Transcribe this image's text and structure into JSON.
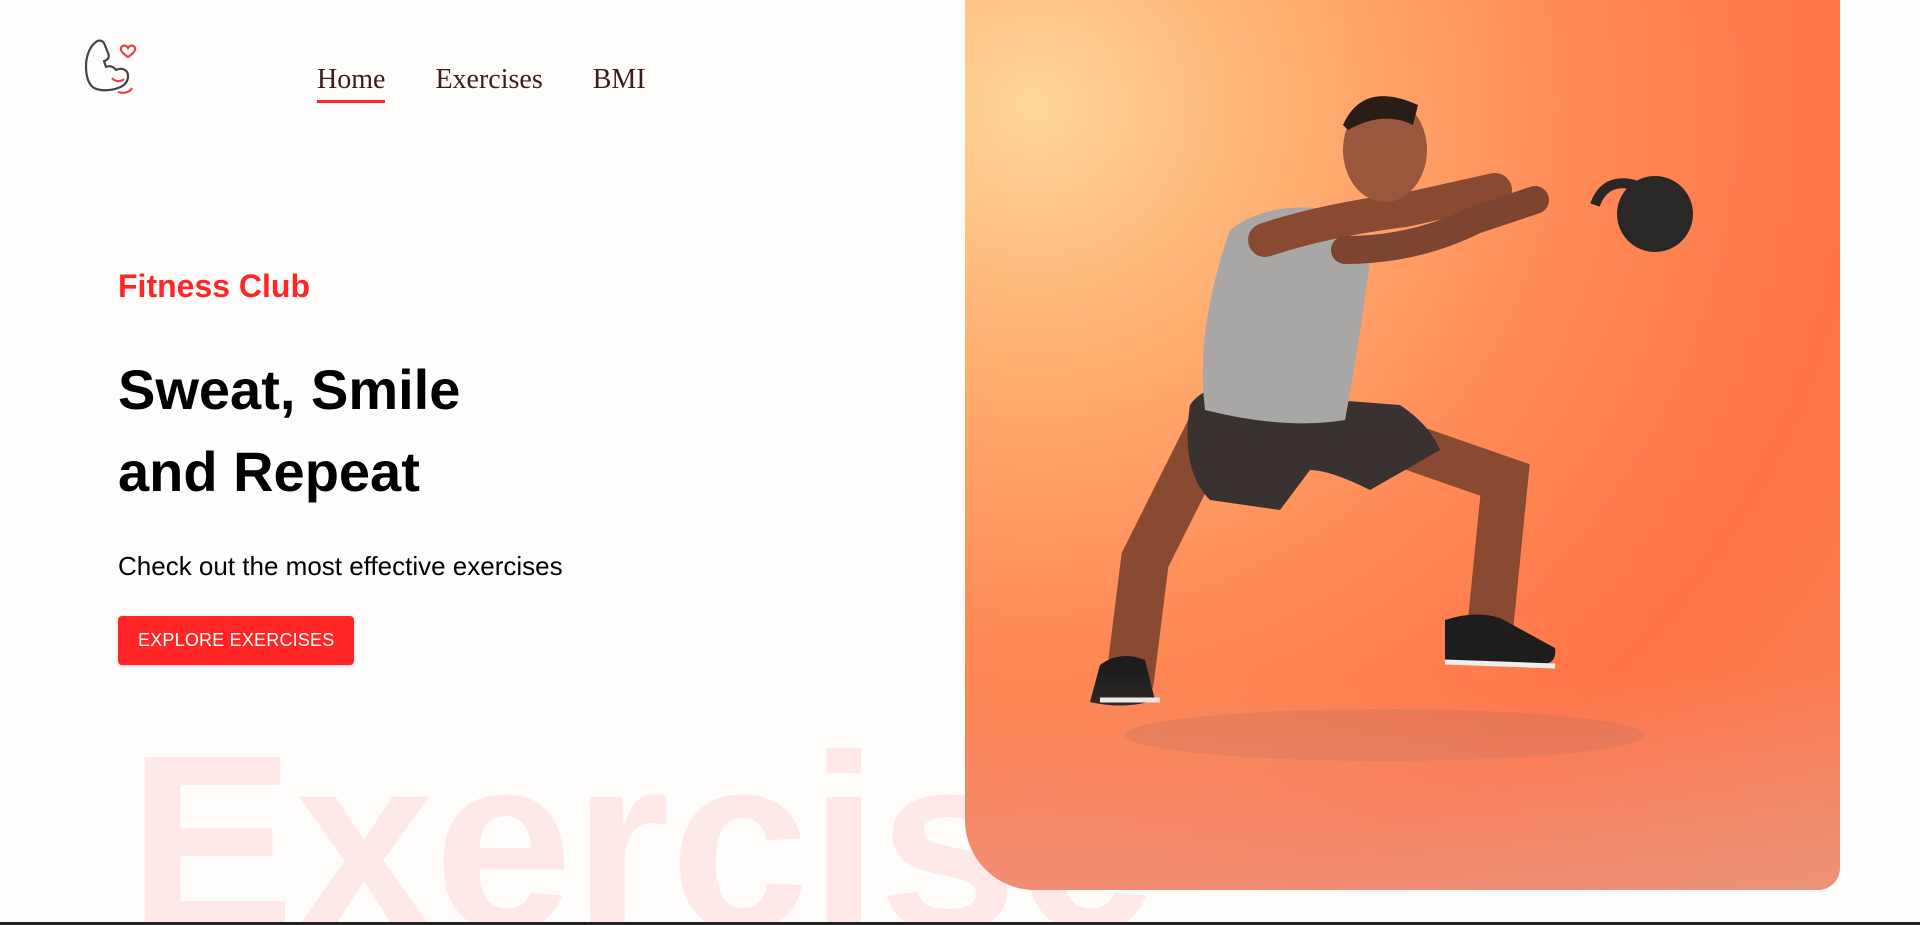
{
  "header": {
    "logo_icon": "flexed-arm-heart-icon",
    "nav": [
      {
        "label": "Home",
        "active": true
      },
      {
        "label": "Exercises",
        "active": false
      },
      {
        "label": "BMI",
        "active": false
      }
    ]
  },
  "hero": {
    "kicker": "Fitness Club",
    "headline_line1": "Sweat, Smile",
    "headline_line2": "and Repeat",
    "subtitle": "Check out the most effective exercises",
    "cta_label": "EXPLORE EXERCISES",
    "watermark": "Exercise",
    "image_icon": "kettlebell-athlete-photo"
  },
  "colors": {
    "accent": "#ff2625",
    "nav_text": "#3a1d1d",
    "background": "#fffcfc"
  }
}
